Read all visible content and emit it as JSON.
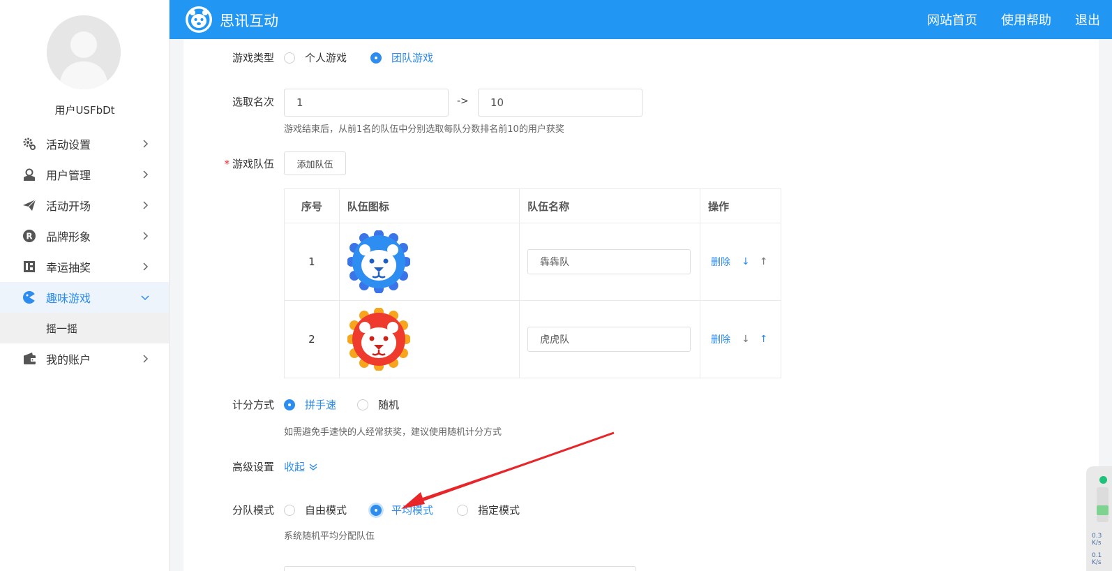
{
  "header": {
    "brand": "思讯互动",
    "nav": [
      "网站首页",
      "使用帮助",
      "退出"
    ]
  },
  "sidebar": {
    "username": "用户USFbDt",
    "items": [
      {
        "label": "活动设置",
        "icon": "gear-icon"
      },
      {
        "label": "用户管理",
        "icon": "user-manage-icon"
      },
      {
        "label": "活动开场",
        "icon": "paper-plane-icon"
      },
      {
        "label": "品牌形象",
        "icon": "registered-icon"
      },
      {
        "label": "幸运抽奖",
        "icon": "lottery-icon"
      },
      {
        "label": "趣味游戏",
        "icon": "game-icon",
        "active": true
      },
      {
        "label": "我的账户",
        "icon": "wallet-icon"
      }
    ],
    "submenu": [
      "摇一摇"
    ]
  },
  "form": {
    "game_type": {
      "label": "游戏类型",
      "options": [
        "个人游戏",
        "团队游戏"
      ],
      "selected": "团队游戏"
    },
    "rank": {
      "label": "选取名次",
      "from": "1",
      "sep": "->",
      "to": "10",
      "hint": "游戏结束后，从前1名的队伍中分别选取每队分数排名前10的用户获奖"
    },
    "teams": {
      "label": "游戏队伍",
      "add_button": "添加队伍",
      "columns": [
        "序号",
        "队伍图标",
        "队伍名称",
        "操作"
      ],
      "rows": [
        {
          "num": "1",
          "icon": "blue-lion-icon",
          "name": "犇犇队",
          "delete": "删除",
          "down": "↓",
          "up": "↑"
        },
        {
          "num": "2",
          "icon": "red-lion-icon",
          "name": "虎虎队",
          "delete": "删除",
          "down": "↓",
          "up": "↑"
        }
      ]
    },
    "scoring": {
      "label": "计分方式",
      "options": [
        "拼手速",
        "随机"
      ],
      "selected": "拼手速",
      "hint": "如需避免手速快的人经常获奖，建议使用随机计分方式"
    },
    "advanced": {
      "label": "高级设置",
      "toggle": "收起"
    },
    "team_mode": {
      "label": "分队模式",
      "options": [
        "自由模式",
        "平均模式",
        "指定模式"
      ],
      "selected": "平均模式",
      "hint": "系统随机平均分配队伍"
    }
  },
  "widget": {
    "upload_speed": "0.3",
    "download_speed": "0.1",
    "unit": "K/s"
  },
  "colors": {
    "header": "#2196f3",
    "accent": "#2d8cf0",
    "annotation_arrow": "#e8262a"
  }
}
